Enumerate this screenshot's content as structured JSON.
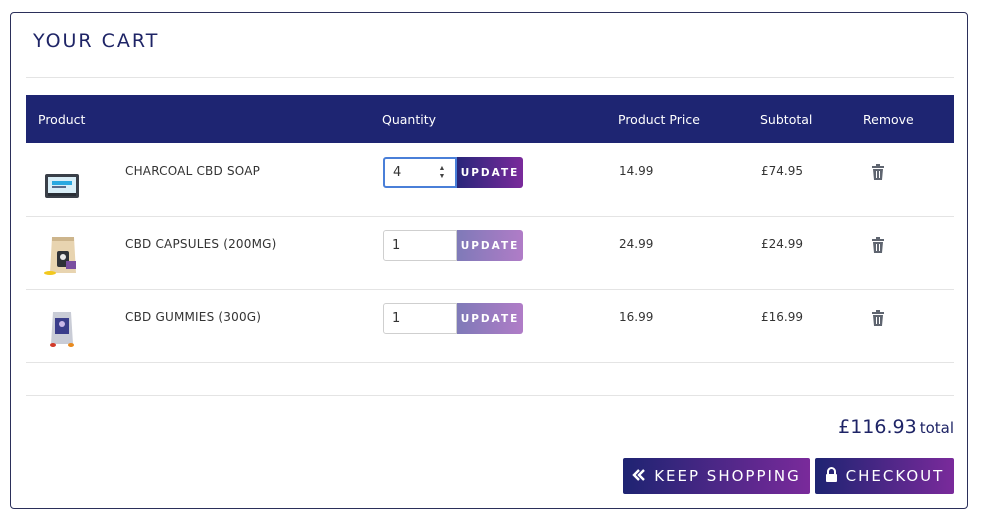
{
  "cart": {
    "title": "YOUR CART",
    "columns": {
      "product": "Product",
      "quantity": "Quantity",
      "price": "Product Price",
      "subtotal": "Subtotal",
      "remove": "Remove"
    },
    "items": [
      {
        "name": "CHARCOAL CBD SOAP",
        "quantity": "4",
        "update_label": "UPDATE",
        "price": "14.99",
        "subtotal": "£74.95",
        "thumbnail_icon": "soap-box-icon"
      },
      {
        "name": "CBD CAPSULES (200MG)",
        "quantity": "1",
        "update_label": "UPDATE",
        "price": "24.99",
        "subtotal": "£24.99",
        "thumbnail_icon": "capsule-pouch-icon"
      },
      {
        "name": "CBD GUMMIES (300G)",
        "quantity": "1",
        "update_label": "UPDATE",
        "price": "16.99",
        "subtotal": "£16.99",
        "thumbnail_icon": "gummies-pouch-icon"
      }
    ],
    "total": {
      "amount": "£116.93",
      "label": "total"
    },
    "actions": {
      "keep_shopping": "KEEP SHOPPING",
      "checkout": "CHECKOUT"
    }
  },
  "colors": {
    "header_bg": "#1e2572",
    "title": "#1e2466",
    "button_gradient_start": "#1e2472",
    "button_gradient_end": "#7a2a9b",
    "active_input_border": "#4a7fd8"
  }
}
